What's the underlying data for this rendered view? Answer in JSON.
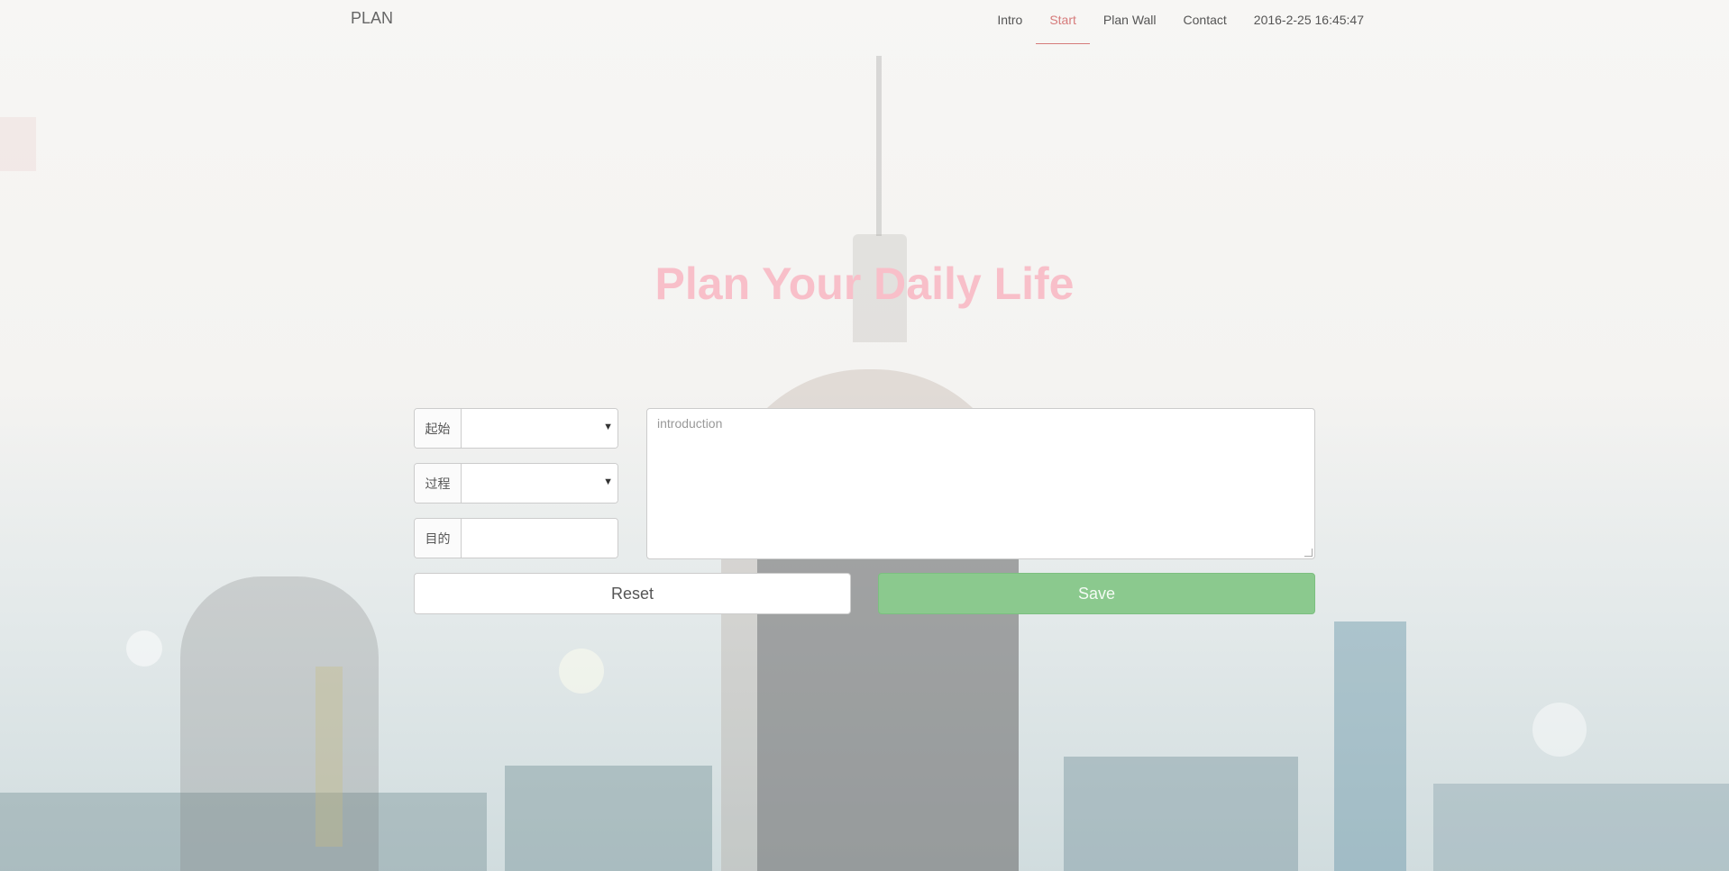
{
  "navbar": {
    "brand": "PLAN",
    "items": [
      {
        "label": "Intro",
        "active": false
      },
      {
        "label": "Start",
        "active": true
      },
      {
        "label": "Plan Wall",
        "active": false
      },
      {
        "label": "Contact",
        "active": false
      }
    ],
    "clock": "2016-2-25 16:45:47",
    "active_color": "#d67b7b"
  },
  "main": {
    "heading": "Plan Your Daily Life",
    "heading_color": "#f8bfc9"
  },
  "form": {
    "start": {
      "label": "起始",
      "value": ""
    },
    "process": {
      "label": "过程",
      "value": ""
    },
    "goal": {
      "label": "目的",
      "value": ""
    },
    "introduction": {
      "placeholder": "introduction",
      "value": ""
    },
    "reset_label": "Reset",
    "save_label": "Save",
    "save_color": "#8bc98e"
  }
}
